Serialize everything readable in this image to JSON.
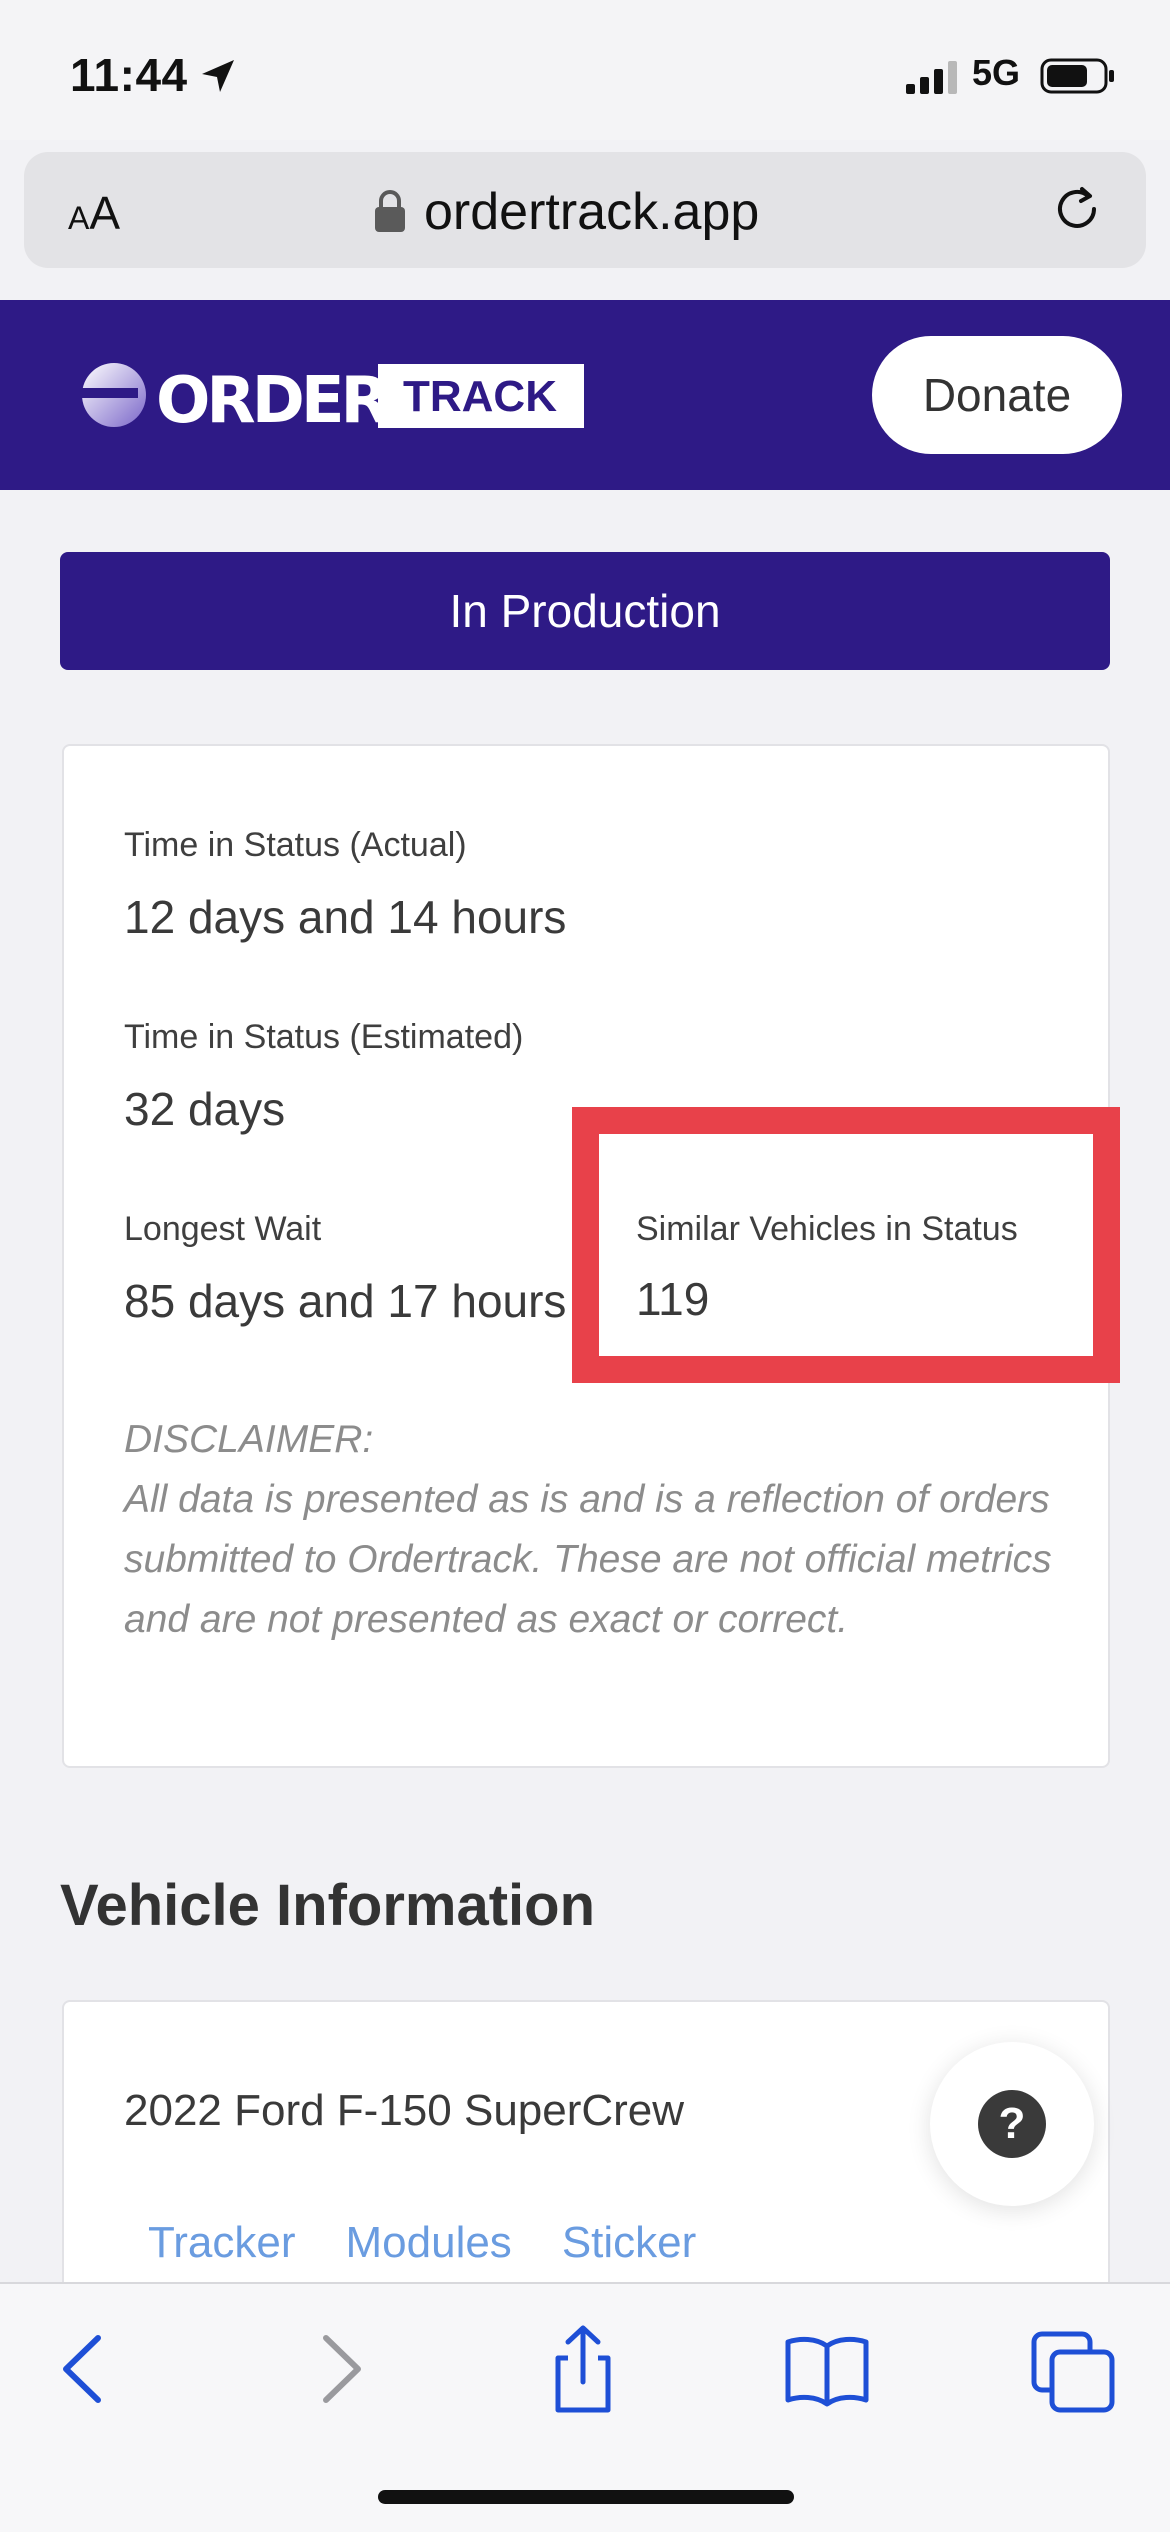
{
  "status_bar": {
    "time": "11:44",
    "network": "5G"
  },
  "browser": {
    "text_size_small": "A",
    "text_size_large": "A",
    "url": "ordertrack.app"
  },
  "header": {
    "logo_part1": "ORDER",
    "logo_part2": "TRACK",
    "donate_label": "Donate"
  },
  "status_banner": "In Production",
  "stats": {
    "actual_label": "Time in Status (Actual)",
    "actual_value": "12 days and 14 hours",
    "estimated_label": "Time in Status (Estimated)",
    "estimated_value": "32 days",
    "longest_label": "Longest Wait",
    "longest_value": "85 days and 17 hours",
    "similar_label": "Similar Vehicles in Status",
    "similar_value": "119"
  },
  "disclaimer": {
    "heading": "DISCLAIMER:",
    "text": "All data is presented as is and is a reflection of orders submitted to Ordertrack. These are not official metrics and are not presented as exact or correct."
  },
  "vehicle": {
    "section_title": "Vehicle Information",
    "name": "2022 Ford F-150 SuperCrew",
    "tabs": [
      "Tracker",
      "Modules",
      "Sticker"
    ]
  },
  "help_label": "?",
  "colors": {
    "brand": "#2e1a86",
    "highlight": "#e8414a",
    "link": "#6a9ce0",
    "toolbar_icons": "#1e4fd6"
  }
}
